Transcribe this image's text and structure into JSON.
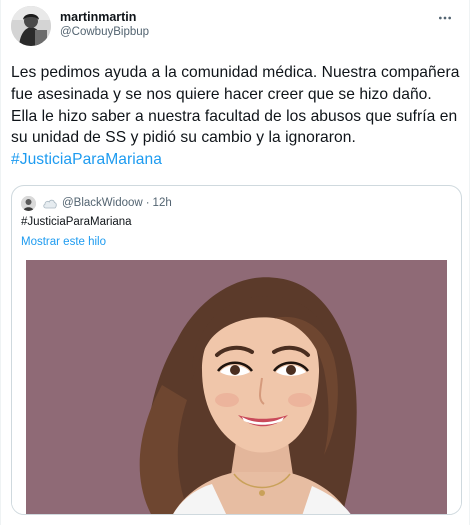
{
  "tweet": {
    "display_name": "martinmartin",
    "handle": "@CowbuyBipbup",
    "text_before_hashtag": "Les pedimos ayuda a la comunidad médica. Nuestra compañera fue asesinada y se nos quiere hacer creer que se hizo daño. Ella le hizo saber a nuestra facultad de los abusos que sufría en su unidad de SS y pidió su cambio y la ignoraron. ",
    "hashtag": "#JusticiaParaMariana"
  },
  "quoted_tweet": {
    "handle": "@BlackWidoow",
    "separator": "·",
    "time": "12h",
    "text": "#JusticiaParaMariana",
    "show_thread_label": "Mostrar este hilo"
  },
  "icons": {
    "more": "more-options-icon",
    "cloud": "cloud-icon"
  },
  "colors": {
    "link": "#1d9bf0",
    "secondary_text": "#536471",
    "border": "#cfd9de",
    "media_background": "#8f6a76"
  }
}
